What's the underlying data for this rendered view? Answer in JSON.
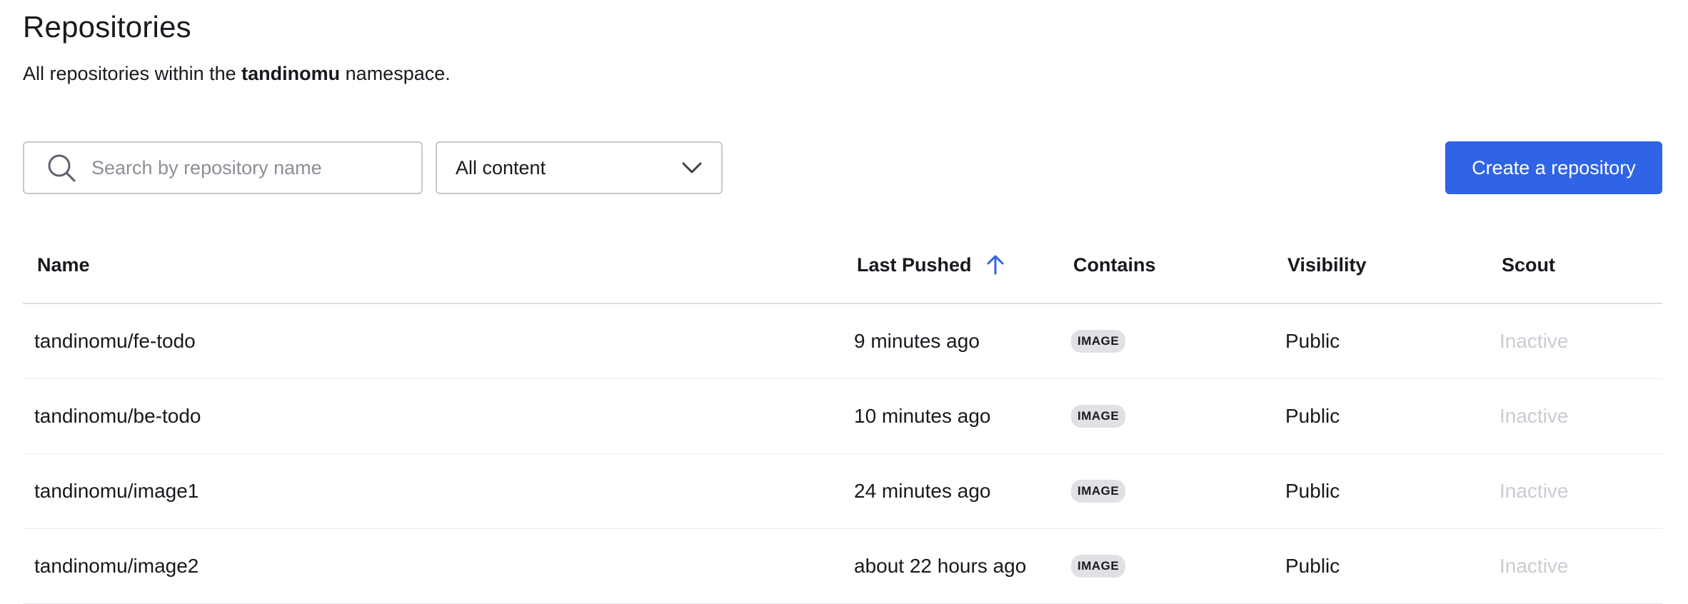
{
  "header": {
    "title": "Repositories",
    "subtitle_prefix": "All repositories within the",
    "namespace": "tandinomu",
    "subtitle_suffix": "namespace."
  },
  "search": {
    "placeholder": "Search by repository name",
    "value": ""
  },
  "filter": {
    "selected": "All content"
  },
  "actions": {
    "create_label": "Create a repository"
  },
  "table": {
    "columns": {
      "name": "Name",
      "last_pushed": "Last Pushed",
      "contains": "Contains",
      "visibility": "Visibility",
      "scout": "Scout"
    },
    "sort": {
      "column": "last_pushed",
      "direction": "ascending"
    },
    "rows": [
      {
        "name": "tandinomu/fe-todo",
        "last_pushed": "9 minutes ago",
        "contains": "IMAGE",
        "visibility": "Public",
        "scout": "Inactive"
      },
      {
        "name": "tandinomu/be-todo",
        "last_pushed": "10 minutes ago",
        "contains": "IMAGE",
        "visibility": "Public",
        "scout": "Inactive"
      },
      {
        "name": "tandinomu/image1",
        "last_pushed": "24 minutes ago",
        "contains": "IMAGE",
        "visibility": "Public",
        "scout": "Inactive"
      },
      {
        "name": "tandinomu/image2",
        "last_pushed": "about 22 hours ago",
        "contains": "IMAGE",
        "visibility": "Public",
        "scout": "Inactive"
      }
    ]
  },
  "colors": {
    "primary": "#2f64e6",
    "border": "#c4c8d1",
    "inactive_text": "#c9ccd2",
    "badge_bg": "#dfe1e4"
  },
  "icons": {
    "search": "search-icon",
    "dropdown": "chevron-down-icon",
    "sort": "arrow-up-icon"
  }
}
